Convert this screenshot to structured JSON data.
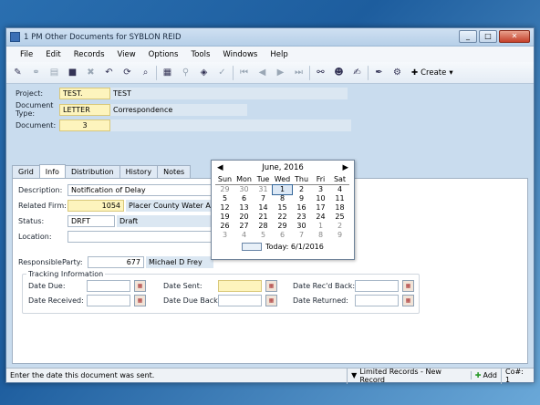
{
  "window": {
    "title": "1 PM Other Documents for SYBLON REID",
    "buttons": [
      "_",
      "□",
      "✕"
    ]
  },
  "menu": [
    "File",
    "Edit",
    "Records",
    "View",
    "Options",
    "Tools",
    "Windows",
    "Help"
  ],
  "toolbar": {
    "create_label": "Create"
  },
  "header": {
    "project": {
      "label": "Project:",
      "code": "TEST.",
      "name": "TEST"
    },
    "doc_type": {
      "label": "Document Type:",
      "code": "LETTER",
      "name": "Correspondence"
    },
    "document": {
      "label": "Document:",
      "number": "3"
    }
  },
  "tabs": [
    "Grid",
    "Info",
    "Distribution",
    "History",
    "Notes"
  ],
  "info": {
    "description": {
      "label": "Description:",
      "value": "Notification of Delay"
    },
    "related_firm": {
      "label": "Related Firm:",
      "number": "1054",
      "name": "Placer County Water Ager"
    },
    "status": {
      "label": "Status:",
      "code": "DRFT",
      "name": "Draft"
    },
    "location": {
      "label": "Location:"
    },
    "responsible": {
      "label": "ResponsibleParty:",
      "number": "677",
      "name": "Michael D Frey"
    },
    "tracking": {
      "title": "Tracking Information",
      "date_due": "Date Due:",
      "date_sent": "Date Sent:",
      "date_recd_back": "Date Rec'd Back:",
      "date_received": "Date Received:",
      "date_due_back": "Date Due Back:",
      "date_returned": "Date Returned:"
    }
  },
  "calendar": {
    "month": "June, 2016",
    "dow": [
      "Sun",
      "Mon",
      "Tue",
      "Wed",
      "Thu",
      "Fri",
      "Sat"
    ],
    "weeks": [
      [
        "29",
        "30",
        "31",
        "1",
        "2",
        "3",
        "4"
      ],
      [
        "5",
        "6",
        "7",
        "8",
        "9",
        "10",
        "11"
      ],
      [
        "12",
        "13",
        "14",
        "15",
        "16",
        "17",
        "18"
      ],
      [
        "19",
        "20",
        "21",
        "22",
        "23",
        "24",
        "25"
      ],
      [
        "26",
        "27",
        "28",
        "29",
        "30",
        "1",
        "2"
      ],
      [
        "3",
        "4",
        "5",
        "6",
        "7",
        "8",
        "9"
      ]
    ],
    "today": "Today: 6/1/2016"
  },
  "status": {
    "message": "Enter the date this document was sent.",
    "records": "Limited Records - New Record",
    "add": "Add",
    "count": "Co#: 1"
  }
}
